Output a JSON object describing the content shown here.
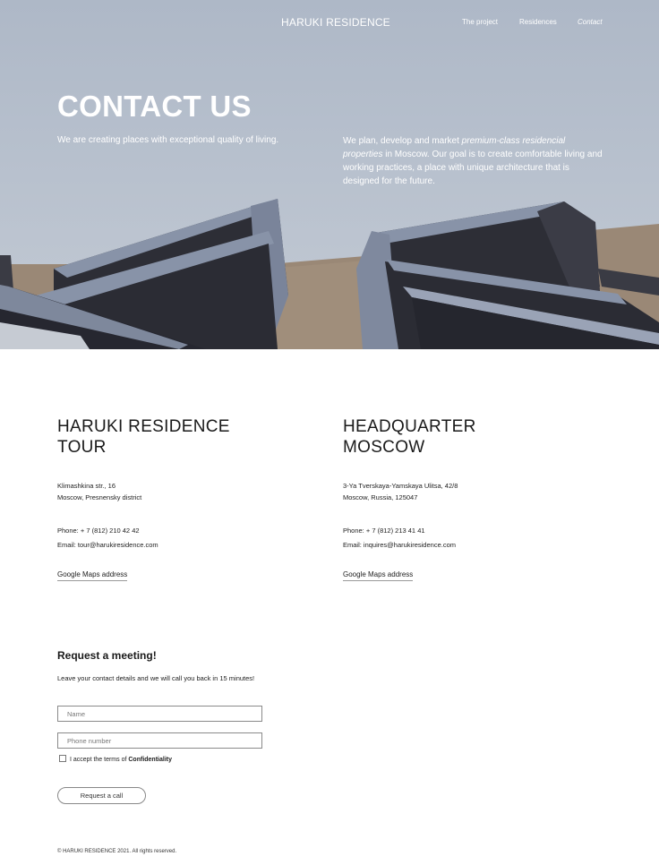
{
  "nav": {
    "brand": "HARUKI RESIDENCE",
    "links": [
      "The project",
      "Residences",
      "Contact"
    ]
  },
  "hero": {
    "title": "CONTACT US",
    "left_text": "We are creating places with exceptional quality of living.",
    "right_text_1": "We plan, develop and market ",
    "right_text_em": "premium-class residencial properties",
    "right_text_2": " in Moscow. Our goal is to create comfortable living and working practices, a place with unique architecture that is designed for the future."
  },
  "offices": [
    {
      "title": "HARUKI RESIDENCE TOUR",
      "address_1": "Klimashkina str., 16",
      "address_2": "Moscow, Presnensky district",
      "phone": "Phone: + 7 (812) 210 42 42",
      "email": "Email: tour@harukiresidence.com",
      "maps": "Google Maps address"
    },
    {
      "title": "HEADQUARTER MOSCOW",
      "address_1": "3-Ya Tverskaya-Yamskaya Ulitsa, 42/8",
      "address_2": "Moscow, Russia, 125047",
      "phone": "Phone: + 7 (812) 213 41 41",
      "email": "Email: inquires@harukiresidence.com",
      "maps": "Google Maps address"
    }
  ],
  "form": {
    "title": "Request a meeting!",
    "subtitle": "Leave your contact details and we will call you back in 15 minutes!",
    "name_placeholder": "Name",
    "phone_placeholder": "Phone number",
    "terms_prefix": "I accept the terms of ",
    "terms_link": "Confidentiality",
    "button": "Request a call"
  },
  "footer": "© HARUKI RESIDENCE 2021. All rights reserved.",
  "colors": {
    "sky": "#b7c0cd",
    "building_dark": "#2a2b33",
    "building_light": "#8a92a6",
    "brick": "#8c7b6a"
  }
}
